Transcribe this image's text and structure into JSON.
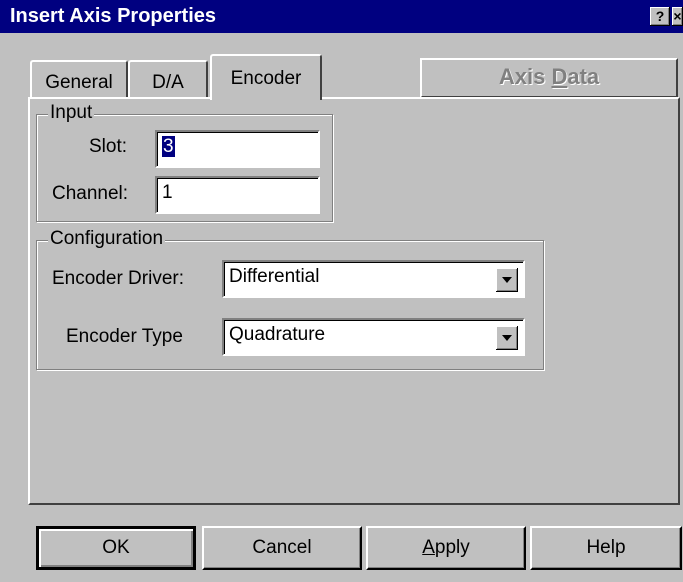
{
  "window": {
    "title": "Insert Axis Properties",
    "help_glyph": "?",
    "close_glyph": "×"
  },
  "tabs": [
    {
      "label": "General"
    },
    {
      "label": "D/A"
    },
    {
      "label": "Encoder"
    }
  ],
  "axis_data_button": {
    "label_pre": "Axis ",
    "label_accel": "D",
    "label_post": "ata"
  },
  "input_group": {
    "label": "Input",
    "slot_label": "Slot:",
    "slot_value": "3",
    "channel_label": "Channel:",
    "channel_value": "1"
  },
  "config_group": {
    "label": "Configuration",
    "driver_label": "Encoder Driver:",
    "driver_value": "Differential",
    "type_label": "Encoder Type",
    "type_value": "Quadrature"
  },
  "buttons": {
    "ok": "OK",
    "cancel": "Cancel",
    "apply_accel": "A",
    "apply_rest": "pply",
    "help": "Help"
  }
}
